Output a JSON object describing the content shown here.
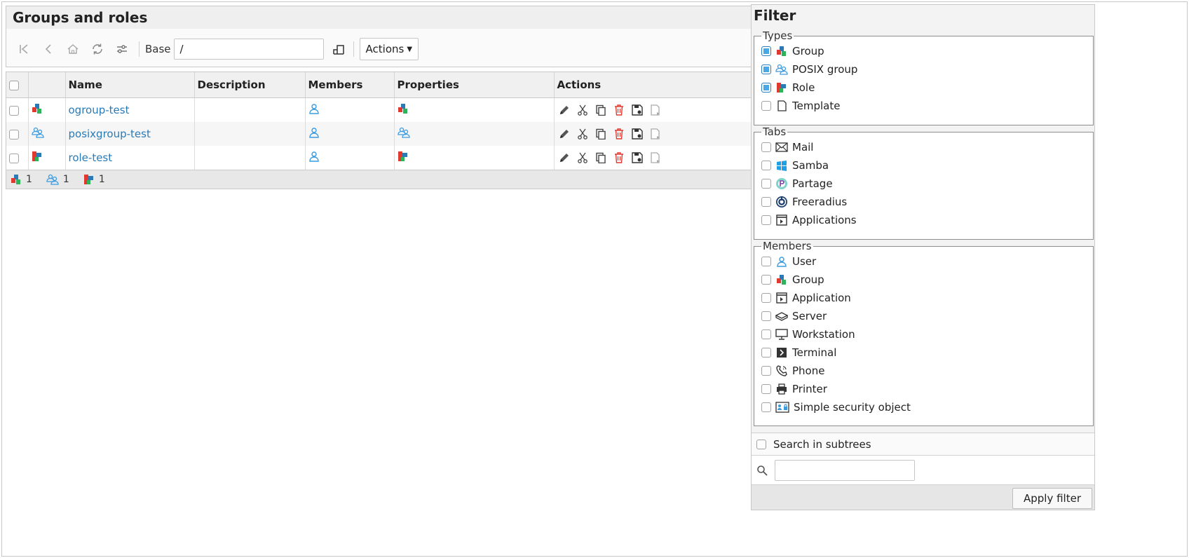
{
  "main": {
    "title": "Groups and roles",
    "toolbar": {
      "base_label": "Base",
      "base_value": "/",
      "actions_label": "Actions"
    },
    "columns": [
      "Name",
      "Description",
      "Members",
      "Properties",
      "Actions"
    ],
    "rows": [
      {
        "name": "ogroup-test",
        "type": "group"
      },
      {
        "name": "posixgroup-test",
        "type": "posix"
      },
      {
        "name": "role-test",
        "type": "role"
      }
    ],
    "footer": {
      "group_count": "1",
      "posix_count": "1",
      "role_count": "1"
    }
  },
  "filter": {
    "title": "Filter",
    "types": {
      "legend": "Types",
      "items": [
        {
          "label": "Group",
          "checked": true
        },
        {
          "label": "POSIX group",
          "checked": true
        },
        {
          "label": "Role",
          "checked": true
        },
        {
          "label": "Template",
          "checked": false
        }
      ]
    },
    "tabs": {
      "legend": "Tabs",
      "items": [
        {
          "label": "Mail"
        },
        {
          "label": "Samba"
        },
        {
          "label": "Partage"
        },
        {
          "label": "Freeradius"
        },
        {
          "label": "Applications"
        }
      ]
    },
    "members": {
      "legend": "Members",
      "items": [
        {
          "label": "User"
        },
        {
          "label": "Group"
        },
        {
          "label": "Application"
        },
        {
          "label": "Server"
        },
        {
          "label": "Workstation"
        },
        {
          "label": "Terminal"
        },
        {
          "label": "Phone"
        },
        {
          "label": "Printer"
        },
        {
          "label": "Simple security object"
        }
      ]
    },
    "search_in_subtrees": "Search in subtrees",
    "apply_label": "Apply filter"
  },
  "colors": {
    "link": "#2a7ab6",
    "checkbox_checked": "#4aa8e6",
    "delete_red": "#e0392f"
  }
}
